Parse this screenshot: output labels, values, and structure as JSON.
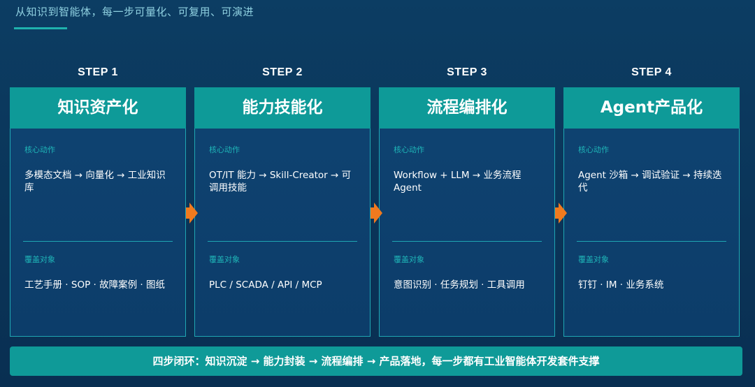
{
  "header": {
    "title": "从知识到智能体，每一步可量化、可复用、可演进"
  },
  "steps": [
    {
      "label": "STEP 1",
      "title": "知识资产化",
      "action_label": "核心动作",
      "action_text": "多模态文档 → 向量化 → 工业知识库",
      "scope_label": "覆盖对象",
      "scope_text": "工艺手册 · SOP · 故障案例 · 图纸"
    },
    {
      "label": "STEP 2",
      "title": "能力技能化",
      "action_label": "核心动作",
      "action_text": "OT/IT 能力 → Skill-Creator → 可调用技能",
      "scope_label": "覆盖对象",
      "scope_text": "PLC / SCADA / API / MCP"
    },
    {
      "label": "STEP 3",
      "title": "流程编排化",
      "action_label": "核心动作",
      "action_text": "Workflow + LLM → 业务流程 Agent",
      "scope_label": "覆盖对象",
      "scope_text": "意图识别 · 任务规划 · 工具调用"
    },
    {
      "label": "STEP 4",
      "title": "Agent产品化",
      "action_label": "核心动作",
      "action_text": "Agent 沙箱 → 调试验证 → 持续迭代",
      "scope_label": "覆盖对象",
      "scope_text": "钉钉 · IM · 业务系统"
    }
  ],
  "footer": {
    "text": "四步闭环：知识沉淀 → 能力封装 → 流程编排 → 产品落地，每一步都有工业智能体开发套件支撑"
  },
  "colors": {
    "accent": "#0e9a98",
    "arrow": "#f07a1e",
    "background": "#0b3b67"
  }
}
